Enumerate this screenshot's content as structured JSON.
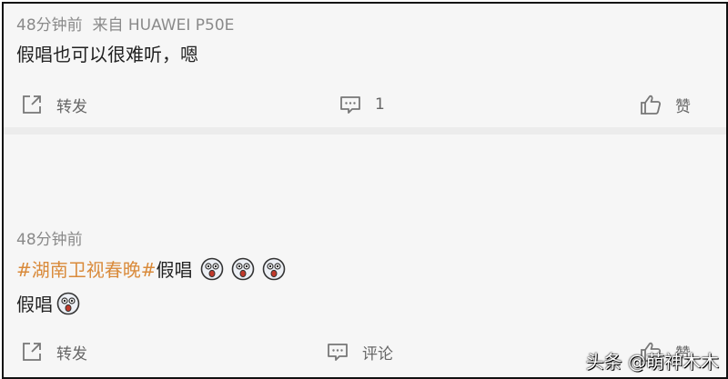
{
  "posts": [
    {
      "time": "48分钟前",
      "source": "来自 HUAWEI P50E",
      "text": "假唱也可以很难听，嗯",
      "actions": {
        "repost": "转发",
        "comment": "1",
        "like": "赞"
      }
    },
    {
      "time": "48分钟前",
      "hashtag": "#湖南卫视春晚#",
      "text_after_tag": "假唱",
      "line2": "假唱",
      "emoji_name": "shocked-face-emoji",
      "actions": {
        "repost": "转发",
        "comment": "评论",
        "like": "赞"
      }
    }
  ],
  "watermark": "头条 @萌神木木",
  "colors": {
    "hashtag": "#d98a3a",
    "meta": "#8a8a8a",
    "background": "#f6f6f6"
  }
}
